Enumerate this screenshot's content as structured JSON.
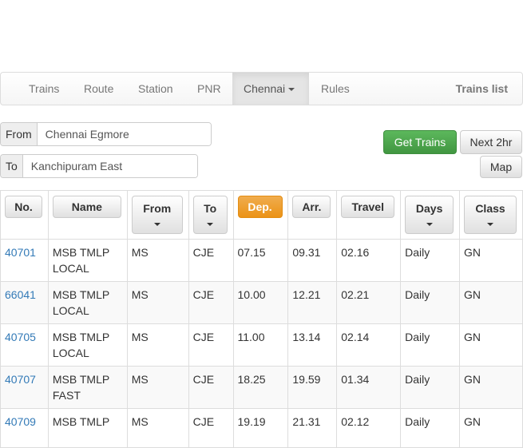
{
  "nav": {
    "items": [
      {
        "label": "Trains"
      },
      {
        "label": "Route"
      },
      {
        "label": "Station"
      },
      {
        "label": "PNR"
      },
      {
        "label": "Chennai"
      },
      {
        "label": "Rules"
      }
    ],
    "brand": "Trains list"
  },
  "search": {
    "from_label": "From",
    "from_value": "Chennai Egmore",
    "to_label": "To",
    "to_value": "Kanchipuram East",
    "get_trains": "Get Trains",
    "next_2hr": "Next 2hr",
    "map": "Map"
  },
  "table": {
    "headers": [
      "No.",
      "Name",
      "From",
      "To",
      "Dep.",
      "Arr.",
      "Travel",
      "Days",
      "Class"
    ],
    "rows": [
      [
        "40701",
        "MSB TMLP LOCAL",
        "MS",
        "CJE",
        "07.15",
        "09.31",
        "02.16",
        "Daily",
        "GN"
      ],
      [
        "66041",
        "MSB TMLP LOCAL",
        "MS",
        "CJE",
        "10.00",
        "12.21",
        "02.21",
        "Daily",
        "GN"
      ],
      [
        "40705",
        "MSB TMLP LOCAL",
        "MS",
        "CJE",
        "11.00",
        "13.14",
        "02.14",
        "Daily",
        "GN"
      ],
      [
        "40707",
        "MSB TMLP FAST",
        "MS",
        "CJE",
        "18.25",
        "19.59",
        "01.34",
        "Daily",
        "GN"
      ],
      [
        "40709",
        "MSB TMLP",
        "MS",
        "CJE",
        "19.19",
        "21.31",
        "02.12",
        "Daily",
        "GN"
      ]
    ]
  },
  "colors": {
    "accent": "#337ab7",
    "success": "#5cb85c",
    "warning": "#f0ad4e"
  }
}
